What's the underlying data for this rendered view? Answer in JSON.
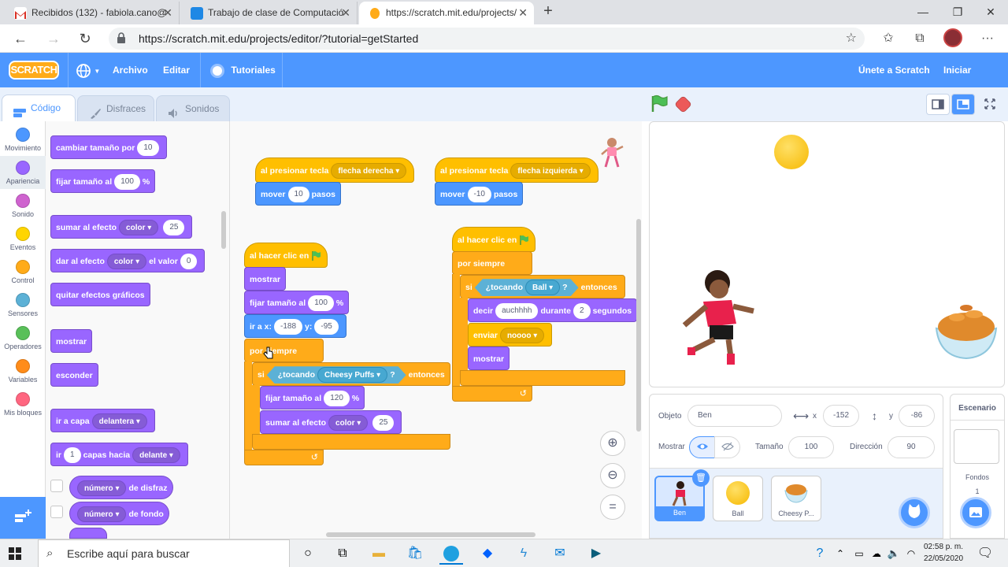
{
  "browser": {
    "tabs": [
      {
        "title": "Recibidos (132) - fabiola.cano@",
        "icon": "gmail-icon"
      },
      {
        "title": "Trabajo de clase de Computació",
        "icon": "classroom-icon"
      },
      {
        "title": "https://scratch.mit.edu/projects/",
        "icon": "scratch-icon"
      }
    ],
    "url": "https://scratch.mit.edu/projects/editor/?tutorial=getStarted"
  },
  "menu": {
    "logo": "SCRATCH",
    "archivo": "Archivo",
    "editar": "Editar",
    "tutoriales": "Tutoriales",
    "join": "Únete a Scratch",
    "signin": "Iniciar sesión"
  },
  "editor_tabs": {
    "code": "Código",
    "costumes": "Disfraces",
    "sounds": "Sonidos"
  },
  "categories": [
    {
      "label": "Movimiento",
      "color": "#4c97ff"
    },
    {
      "label": "Apariencia",
      "color": "#9966ff"
    },
    {
      "label": "Sonido",
      "color": "#cf63cf"
    },
    {
      "label": "Eventos",
      "color": "#ffd500"
    },
    {
      "label": "Control",
      "color": "#ffab19"
    },
    {
      "label": "Sensores",
      "color": "#5cb1d6"
    },
    {
      "label": "Operadores",
      "color": "#59c059"
    },
    {
      "label": "Variables",
      "color": "#ff8c1a"
    },
    {
      "label": "Mis bloques",
      "color": "#ff6680"
    }
  ],
  "palette": {
    "change_size": "cambiar tamaño por",
    "change_size_val": "10",
    "set_size": "fijar tamaño al",
    "set_size_val": "100",
    "percent": "%",
    "add_effect": "sumar al efecto",
    "effect_color": "color",
    "add_effect_val": "25",
    "set_effect": "dar al efecto",
    "set_effect_value": "el valor",
    "set_effect_val": "0",
    "clear_effects": "quitar efectos gráficos",
    "show": "mostrar",
    "hide": "esconder",
    "go_layer": "ir a capa",
    "layer_front": "delantera",
    "go": "ir",
    "go_val": "1",
    "layers_toward": "capas hacia",
    "toward_front": "delante",
    "costume_number": "número",
    "of_costume": "de disfraz",
    "backdrop_number": "número",
    "of_backdrop": "de fondo"
  },
  "scripts": {
    "s1_when_key": "al presionar tecla",
    "s1_key": "flecha derecha",
    "s1_move": "mover",
    "s1_move_val": "10",
    "s1_steps": "pasos",
    "s2_when_key": "al presionar tecla",
    "s2_key": "flecha izquierda",
    "s2_move": "mover",
    "s2_move_val": "-10",
    "s2_steps": "pasos",
    "s3_when_flag": "al hacer clic en",
    "s3_show": "mostrar",
    "s3_set_size": "fijar tamaño al",
    "s3_set_size_val": "100",
    "s3_percent": "%",
    "s3_goto": "ir a x:",
    "s3_x": "-188",
    "s3_y_label": "y:",
    "s3_y": "-95",
    "s3_forever": "por siempre",
    "s3_if": "si",
    "s3_touching": "¿tocando",
    "s3_touch_obj": "Cheesy Puffs",
    "s3_q": "?",
    "s3_then": "entonces",
    "s3_set_size2": "fijar tamaño al",
    "s3_set_size2_val": "120",
    "s3_percent2": "%",
    "s3_add_effect": "sumar al efecto",
    "s3_effect": "color",
    "s3_effect_val": "25",
    "s4_when_flag": "al hacer clic en",
    "s4_forever": "por siempre",
    "s4_if": "si",
    "s4_touching": "¿tocando",
    "s4_touch_obj": "Ball",
    "s4_q": "?",
    "s4_then": "entonces",
    "s4_say": "decir",
    "s4_say_text": "auchhhh",
    "s4_for": "durante",
    "s4_secs_val": "2",
    "s4_seconds": "segundos",
    "s4_broadcast": "enviar",
    "s4_message": "noooo",
    "s4_show": "mostrar"
  },
  "sprite_info": {
    "label_sprite": "Objeto",
    "name": "Ben",
    "x_label": "x",
    "x": "-152",
    "y_label": "y",
    "y": "-86",
    "show_label": "Mostrar",
    "size_label": "Tamaño",
    "size": "100",
    "direction_label": "Dirección",
    "direction": "90"
  },
  "sprites": [
    {
      "name": "Ben",
      "selected": true
    },
    {
      "name": "Ball",
      "selected": false
    },
    {
      "name": "Cheesy P...",
      "selected": false
    }
  ],
  "stage_panel": {
    "title": "Escenario",
    "backdrops_label": "Fondos",
    "backdrops_count": "1"
  },
  "taskbar": {
    "search_placeholder": "Escribe aquí para buscar",
    "time": "02:58 p. m.",
    "date": "22/05/2020"
  },
  "colors": {
    "scratch_blue": "#4d97ff",
    "looks": "#9966ff",
    "motion": "#4c97ff",
    "events": "#ffbf00",
    "control": "#ffab19",
    "sensing": "#5cb1d6"
  }
}
